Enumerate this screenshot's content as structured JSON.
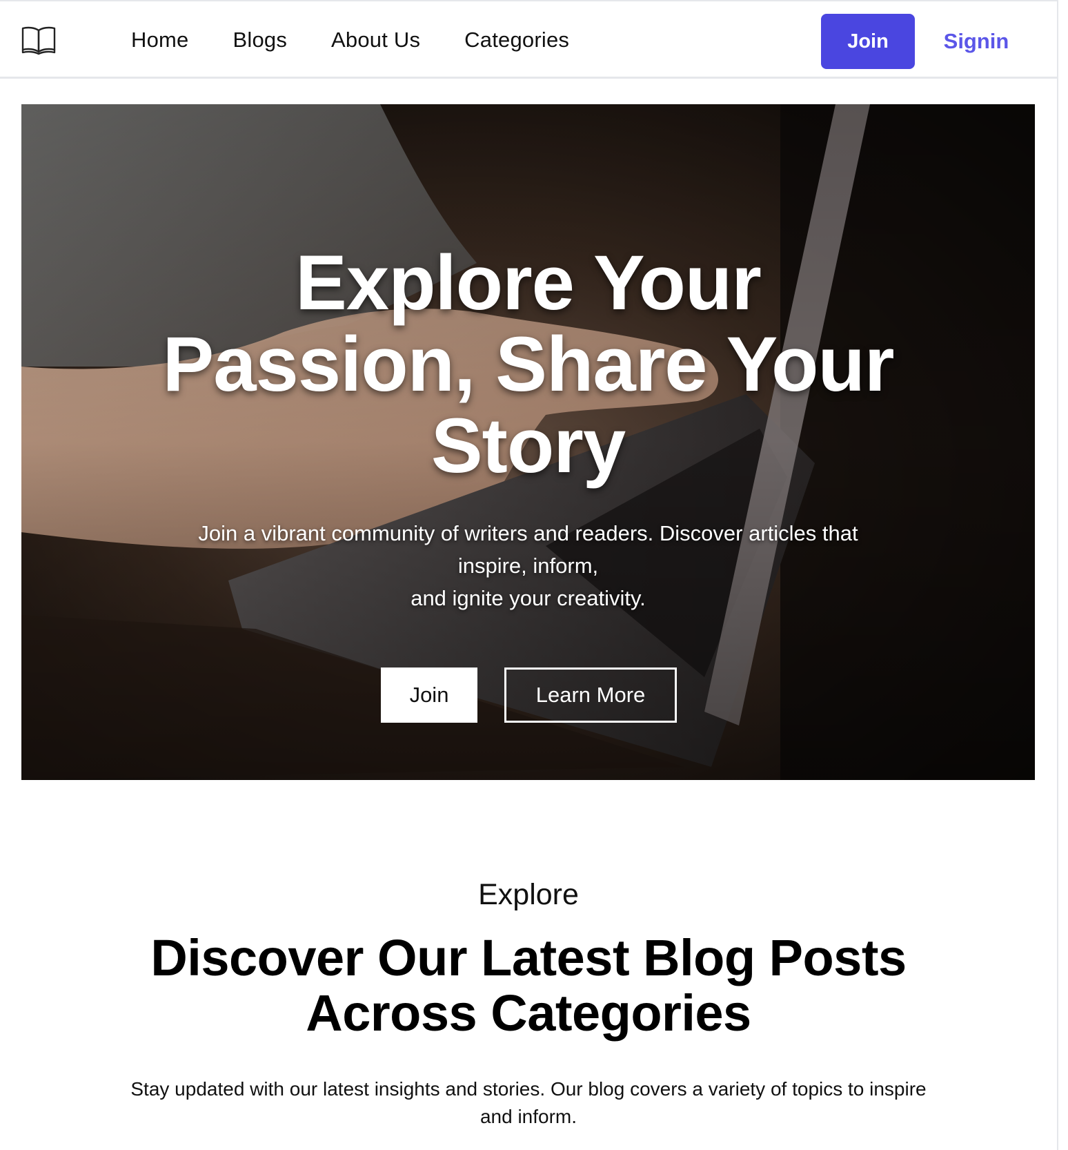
{
  "nav": {
    "logo_icon": "open-book-icon",
    "links": [
      "Home",
      "Blogs",
      "About Us",
      "Categories"
    ],
    "join_label": "Join",
    "signin_label": "Signin",
    "accent_color": "#4a46e0"
  },
  "hero": {
    "title_lines": [
      "Explore Your",
      "Passion, Share Your",
      "Story"
    ],
    "subtitle_lines": [
      "Join a vibrant community of writers and readers. Discover articles that",
      "inspire, inform,",
      "and ignite your creativity."
    ],
    "join_label": "Join",
    "learn_more_label": "Learn More"
  },
  "explore": {
    "eyebrow": "Explore",
    "heading_lines": [
      "Discover Our Latest Blog Posts",
      "Across Categories"
    ],
    "description_lines": [
      "Stay updated with our latest insights and stories. Our blog covers a variety of topics to inspire",
      "and inform."
    ]
  }
}
